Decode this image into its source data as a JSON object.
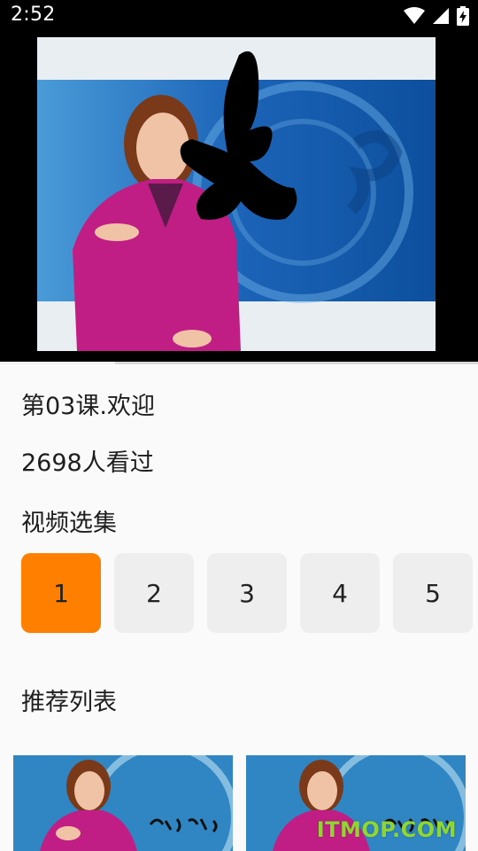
{
  "status_bar": {
    "time": "2:52"
  },
  "player": {
    "progress": 0.24
  },
  "lesson": {
    "title": "第03课.欢迎",
    "views": "2698人看过"
  },
  "episodes": {
    "heading": "视频选集",
    "items": [
      "1",
      "2",
      "3",
      "4",
      "5"
    ],
    "selected": "1"
  },
  "recommend": {
    "heading": "推荐列表"
  },
  "watermark": "ITMOP.COM",
  "colors": {
    "accent": "#ff7f00",
    "status_bar": "#000000",
    "background": "#fafafa"
  }
}
